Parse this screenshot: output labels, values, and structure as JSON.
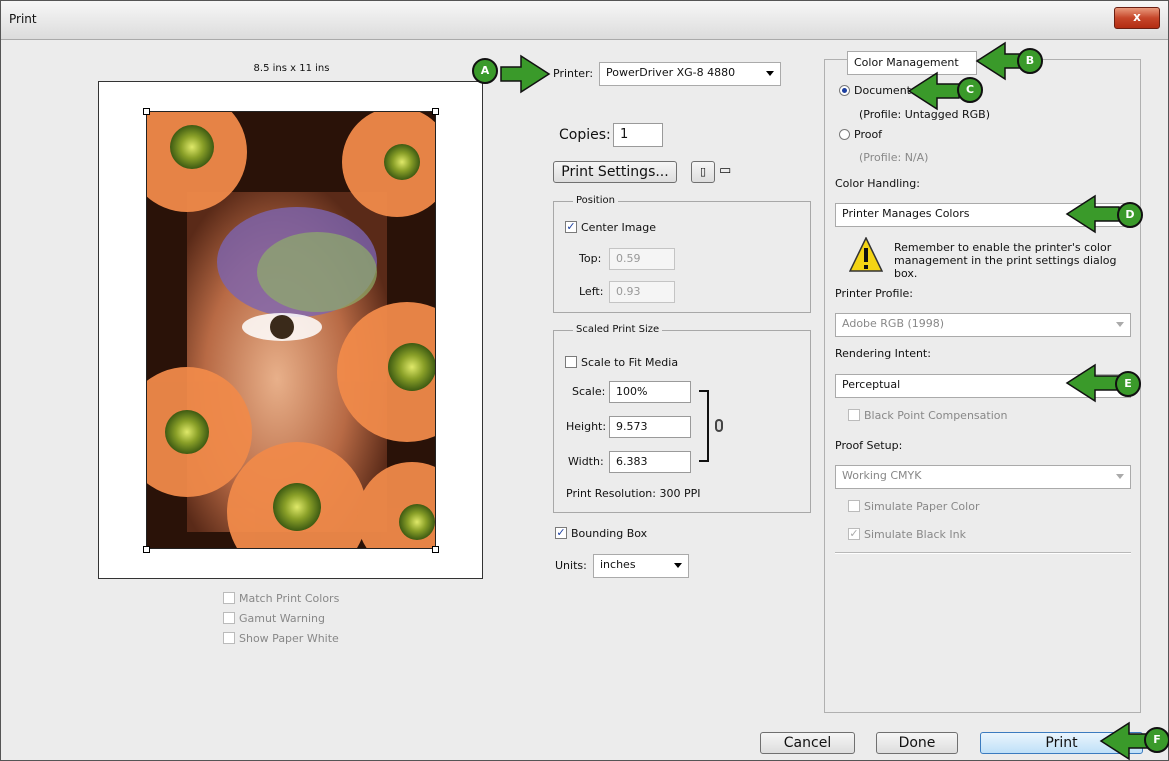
{
  "window": {
    "title": "Print",
    "close_label": "x"
  },
  "preview": {
    "paper_size": "8.5 ins x 11 ins",
    "checks": [
      {
        "label": "Match Print Colors",
        "checked": false
      },
      {
        "label": "Gamut Warning",
        "checked": false
      },
      {
        "label": "Show Paper White",
        "checked": false
      }
    ]
  },
  "printer": {
    "label": "Printer:",
    "value": "PowerDriver XG-8 4880"
  },
  "copies": {
    "label": "Copies:",
    "value": "1"
  },
  "print_settings_label": "Print Settings...",
  "position": {
    "legend": "Position",
    "center_image": "Center Image",
    "top_label": "Top:",
    "top_value": "0.59",
    "left_label": "Left:",
    "left_value": "0.93"
  },
  "scaled": {
    "legend": "Scaled Print Size",
    "fit_label": "Scale to Fit Media",
    "scale_label": "Scale:",
    "scale_value": "100%",
    "height_label": "Height:",
    "height_value": "9.573",
    "width_label": "Width:",
    "width_value": "6.383",
    "resolution": "Print Resolution: 300 PPI"
  },
  "bounding_box": "Bounding Box",
  "units": {
    "label": "Units:",
    "value": "inches"
  },
  "color": {
    "section": "Color Management",
    "document": "Document",
    "document_profile": "(Profile: Untagged RGB)",
    "proof": "Proof",
    "proof_profile": "(Profile: N/A)",
    "handling_label": "Color Handling:",
    "handling_value": "Printer Manages Colors",
    "warning": "Remember to enable the printer's color management in the print settings dialog box.",
    "printer_profile_label": "Printer Profile:",
    "printer_profile_value": "Adobe RGB (1998)",
    "intent_label": "Rendering Intent:",
    "intent_value": "Perceptual",
    "bpc": "Black Point Compensation",
    "proof_setup_label": "Proof Setup:",
    "proof_setup_value": "Working CMYK",
    "sim_paper": "Simulate Paper Color",
    "sim_ink": "Simulate Black Ink"
  },
  "buttons": {
    "cancel": "Cancel",
    "done": "Done",
    "print": "Print"
  },
  "callouts": {
    "a": "A",
    "b": "B",
    "c": "C",
    "d": "D",
    "e": "E",
    "f": "F"
  },
  "colors": {
    "callout_green": "#3a9a2a",
    "accent_blue": "#1c3fa0"
  }
}
